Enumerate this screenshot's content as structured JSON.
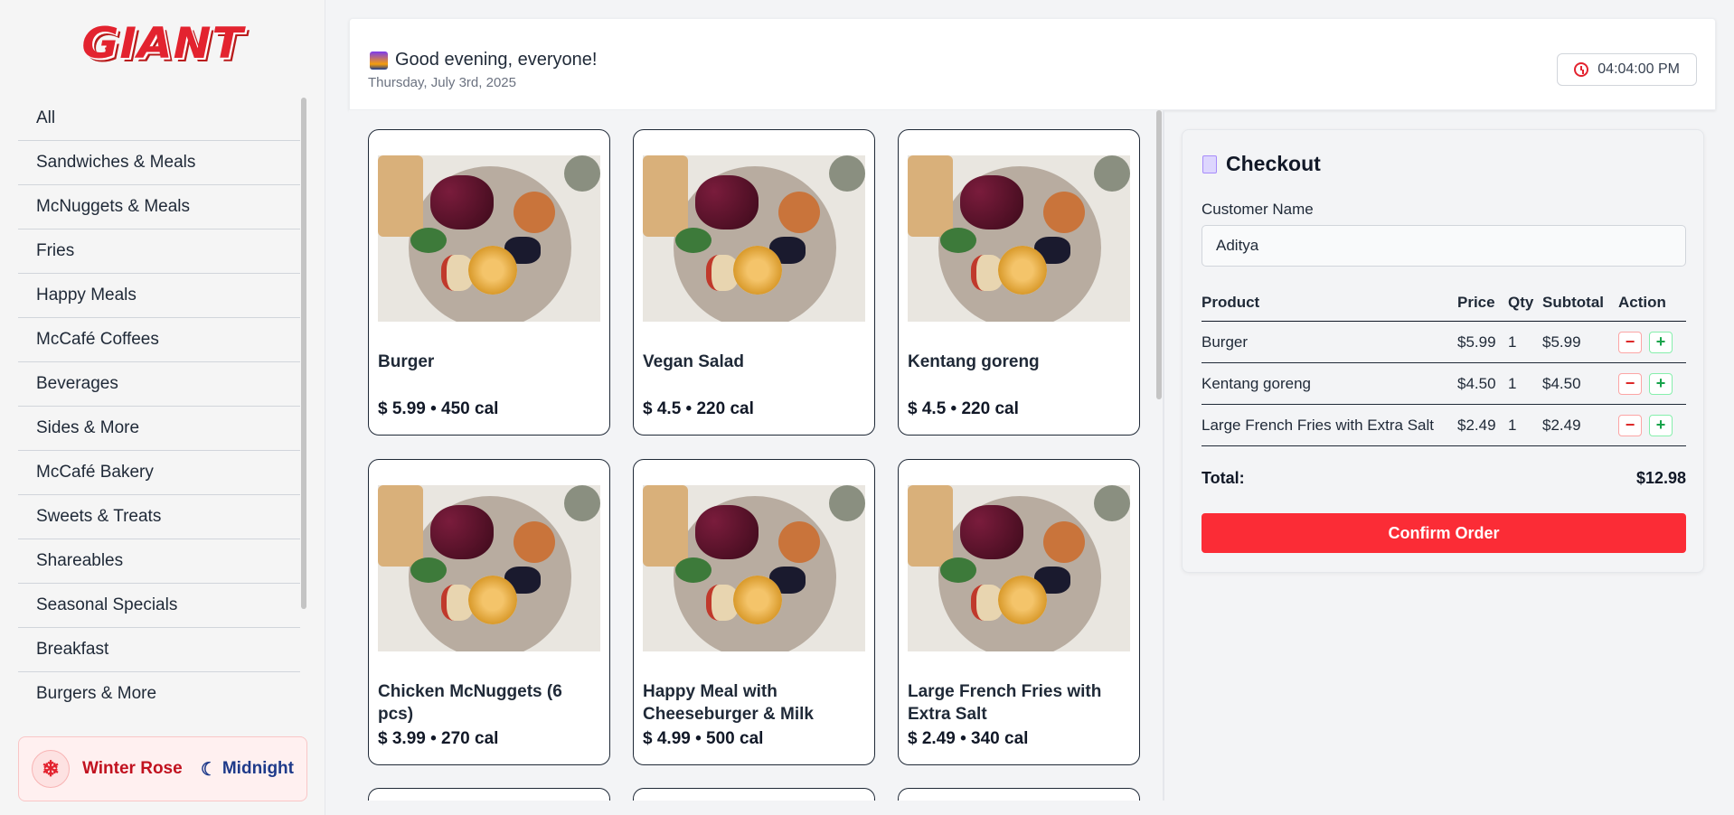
{
  "brand": {
    "logo_text": "GIANT",
    "accent": "#e3232f"
  },
  "sidebar": {
    "categories": [
      "All",
      "Sandwiches & Meals",
      "McNuggets & Meals",
      "Fries",
      "Happy Meals",
      "McCafé Coffees",
      "Beverages",
      "Sides & More",
      "McCafé Bakery",
      "Sweets & Treats",
      "Shareables",
      "Seasonal Specials",
      "Breakfast",
      "Burgers & More"
    ],
    "themes": {
      "winter_label": "Winter Rose",
      "winter_icon": "snowflake-icon",
      "midnight_label": "Midnight",
      "midnight_icon": "moon-icon"
    }
  },
  "header": {
    "greeting": "Good evening, everyone!",
    "date": "Thursday, July 3rd, 2025",
    "time": "04:04:00 PM"
  },
  "products": [
    {
      "name": "Burger",
      "price": "$ 5.99 • 450 cal"
    },
    {
      "name": "Vegan Salad",
      "price": "$ 4.5 • 220 cal"
    },
    {
      "name": "Kentang goreng",
      "price": "$ 4.5 • 220 cal"
    },
    {
      "name": "Chicken McNuggets (6 pcs)",
      "price": "$ 3.99 • 270 cal"
    },
    {
      "name": "Happy Meal with Cheeseburger & Milk",
      "price": "$ 4.99 • 500 cal"
    },
    {
      "name": "Large French Fries with Extra Salt",
      "price": "$ 2.49 • 340 cal"
    }
  ],
  "checkout": {
    "title": "Checkout",
    "customer_label": "Customer Name",
    "customer_value": "Aditya",
    "columns": {
      "product": "Product",
      "price": "Price",
      "qty": "Qty",
      "subtotal": "Subtotal",
      "action": "Action"
    },
    "items": [
      {
        "product": "Burger",
        "price": "$5.99",
        "qty": "1",
        "subtotal": "$5.99"
      },
      {
        "product": "Kentang goreng",
        "price": "$4.50",
        "qty": "1",
        "subtotal": "$4.50"
      },
      {
        "product": "Large French Fries with Extra Salt",
        "price": "$2.49",
        "qty": "1",
        "subtotal": "$2.49"
      }
    ],
    "minus_symbol": "−",
    "plus_symbol": "+",
    "total_label": "Total:",
    "total_value": "$12.98",
    "confirm_label": "Confirm Order"
  }
}
